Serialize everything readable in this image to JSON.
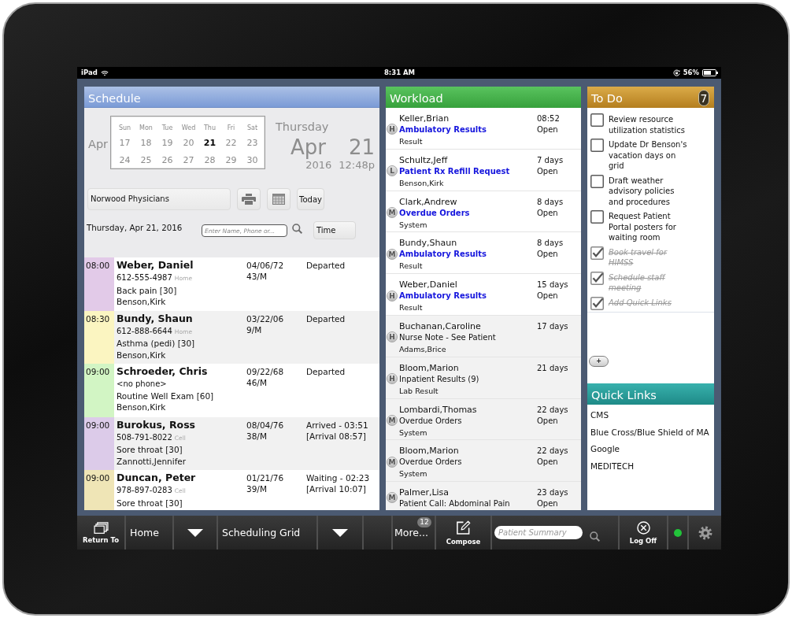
{
  "status_bar": {
    "device": "iPad",
    "time": "8:31 AM",
    "battery": "56%"
  },
  "schedule": {
    "title": "Schedule",
    "calendar": {
      "month": "Apr",
      "weekdays": [
        "Sun",
        "Mon",
        "Tue",
        "Wed",
        "Thu",
        "Fri",
        "Sat"
      ],
      "weeks": [
        [
          {
            "day": "17",
            "selected": false
          },
          {
            "day": "18",
            "selected": false
          },
          {
            "day": "19",
            "selected": false
          },
          {
            "day": "20",
            "selected": false
          },
          {
            "day": "21",
            "selected": true
          },
          {
            "day": "22",
            "selected": false
          },
          {
            "day": "23",
            "selected": false
          }
        ],
        [
          {
            "day": "24",
            "selected": false
          },
          {
            "day": "25",
            "selected": false
          },
          {
            "day": "26",
            "selected": false
          },
          {
            "day": "27",
            "selected": false
          },
          {
            "day": "28",
            "selected": false
          },
          {
            "day": "29",
            "selected": false
          },
          {
            "day": "30",
            "selected": false
          }
        ]
      ]
    },
    "current": {
      "weekday": "Thursday",
      "month": "Apr",
      "day": "21",
      "year": "2016",
      "time": "12:48p"
    },
    "location": "Norwood Physicians",
    "today_button": "Today",
    "date_label": "Thursday, Apr 21, 2016",
    "search": {
      "placeholder": "Enter Name, Phone or..."
    },
    "sort_button": "Time",
    "appointments": [
      {
        "time": "08:00",
        "color": "#e2cae8",
        "name": "Weber, Daniel",
        "phone": "612-555-4987",
        "phone_type": "Home",
        "reason": "Back pain [30]",
        "provider": "Benson,Kirk",
        "dob": "04/06/72",
        "age_sex": "43/M",
        "status": "Departed"
      },
      {
        "time": "08:30",
        "color": "#fbf5c1",
        "name": "Bundy, Shaun",
        "phone": "612-888-6644",
        "phone_type": "Home",
        "reason": "Asthma (pedi) [30]",
        "provider": "Benson,Kirk",
        "dob": "03/22/06",
        "age_sex": "9/M",
        "status": "Departed"
      },
      {
        "time": "09:00",
        "color": "#d2f5c4",
        "name": "Schroeder, Chris",
        "phone": "<no phone>",
        "reason": "Routine Well Exam [60]",
        "provider": "Benson,Kirk",
        "dob": "09/22/68",
        "age_sex": "46/M",
        "status": "Departed"
      },
      {
        "time": "09:00",
        "color": "#dccbe9",
        "name": "Burokus, Ross",
        "phone": "508-791-8022",
        "phone_type": "Cell",
        "reason": "Sore throat [30]",
        "provider": "Zannotti,Jennifer",
        "dob": "08/04/76",
        "age_sex": "38/M",
        "status": "Arrived - 03:51",
        "arrival": "[Arrival 08:57]"
      },
      {
        "time": "09:00",
        "color": "#efe5b6",
        "name": "Duncan, Peter",
        "phone": "978-897-0283",
        "phone_type": "Cell",
        "reason": "Sore throat [30]",
        "dob": "01/21/76",
        "age_sex": "39/M",
        "status": "Waiting - 02:23",
        "arrival": "[Arrival 10:07]"
      }
    ]
  },
  "workload": {
    "title": "Workload",
    "items": [
      {
        "priority": "H",
        "name": "Keller,Brian",
        "type": "Ambulatory Results",
        "detail": "Result",
        "age": "08:52",
        "status": "Open",
        "unread": true
      },
      {
        "priority": "L",
        "name": "Schultz,Jeff",
        "type": "Patient Rx Refill Request",
        "detail": "Benson,Kirk",
        "age": "7 days",
        "status": "Open",
        "unread": true
      },
      {
        "priority": "M",
        "name": "Clark,Andrew",
        "type": "Overdue Orders",
        "detail": "System",
        "age": "8 days",
        "status": "Open",
        "unread": true
      },
      {
        "priority": "M",
        "name": "Bundy,Shaun",
        "type": "Ambulatory Results",
        "detail": "Result",
        "age": "8 days",
        "status": "Open",
        "unread": true
      },
      {
        "priority": "H",
        "name": "Weber,Daniel",
        "type": "Ambulatory Results",
        "detail": "Result",
        "age": "15 days",
        "status": "Open",
        "unread": true
      },
      {
        "priority": "H",
        "name": "Buchanan,Caroline",
        "type": "Nurse Note - See Patient",
        "detail": "Adams,Brice",
        "age": "17 days",
        "unread": false
      },
      {
        "priority": "H",
        "name": "Bloom,Marion",
        "type": "Inpatient Results (9)",
        "detail": "Lab Result",
        "age": "21 days",
        "unread": false
      },
      {
        "priority": "M",
        "name": "Lombardi,Thomas",
        "type": "Overdue Orders",
        "detail": "System",
        "age": "22 days",
        "status": "Open",
        "unread": false
      },
      {
        "priority": "M",
        "name": "Bloom,Marion",
        "type": "Overdue Orders",
        "detail": "System",
        "age": "22 days",
        "status": "Open",
        "unread": false
      },
      {
        "priority": "M",
        "name": "Palmer,Lisa",
        "type": "Patient Call: Abdominal Pain",
        "age": "23 days",
        "status": "Open",
        "unread": false
      }
    ]
  },
  "todo": {
    "title": "To Do",
    "count": "7",
    "items": [
      {
        "text": "Review resource utilization statistics",
        "checked": false
      },
      {
        "text": "Update Dr Benson's vacation days on grid",
        "checked": false
      },
      {
        "text": "Draft weather advisory policies and procedures",
        "checked": false
      },
      {
        "text": "Request Patient Portal posters for waiting room",
        "checked": false
      },
      {
        "text": "Book travel for HIMSS",
        "checked": true
      },
      {
        "text": "Schedule staff meeting",
        "checked": true
      },
      {
        "text": "Add Quick Links",
        "checked": true
      }
    ],
    "add_button": "+"
  },
  "quick_links": {
    "title": "Quick Links",
    "links": [
      "CMS",
      "Blue Cross/Blue Shield of MA",
      "Google",
      "MEDITECH"
    ]
  },
  "toolbar": {
    "return_button": "Return To",
    "home_button": "Home",
    "view_button": "Scheduling Grid",
    "more_button": "More...",
    "more_count": "12",
    "compose_button": "Compose",
    "search": {
      "placeholder": "Patient Summary"
    },
    "logoff_button": "Log Off",
    "connected": true
  }
}
